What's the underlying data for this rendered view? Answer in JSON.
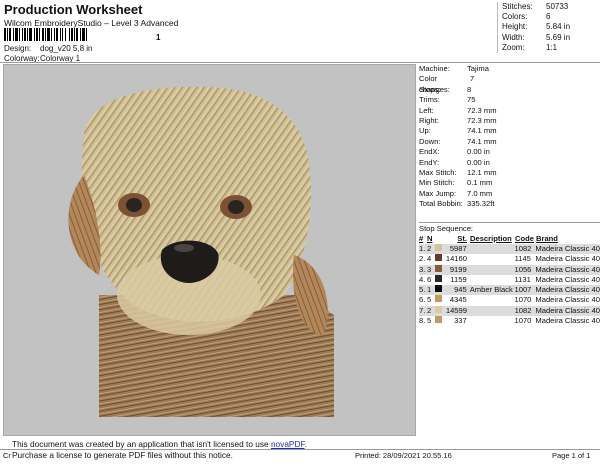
{
  "header": {
    "title": "Production Worksheet",
    "subtitle": "Wilcom EmbroideryStudio – Level 3 Advanced",
    "barcode_suffix": "1",
    "design_label": "Design:",
    "design_value": "dog_v20 5,8 in",
    "colorway_label": "Colorway:",
    "colorway_value": "Colorway 1"
  },
  "stats": [
    {
      "k": "Stitches:",
      "v": "50733"
    },
    {
      "k": "Colors:",
      "v": "6"
    },
    {
      "k": "Height:",
      "v": "5.84 in"
    },
    {
      "k": "Width:",
      "v": "5.69 in"
    },
    {
      "k": "Zoom:",
      "v": "1:1"
    }
  ],
  "machine_info": [
    {
      "k": "Machine:",
      "v": "Tajima"
    },
    {
      "k": "Color changes:",
      "v": "7"
    },
    {
      "k": "Stops:",
      "v": "8"
    },
    {
      "k": "Trims:",
      "v": "75"
    },
    {
      "k": "Left:",
      "v": "72.3 mm"
    },
    {
      "k": "Right:",
      "v": "72.3 mm"
    },
    {
      "k": "Up:",
      "v": "74.1 mm"
    },
    {
      "k": "Down:",
      "v": "74.1 mm"
    },
    {
      "k": "EndX:",
      "v": "0.00 in"
    },
    {
      "k": "EndY:",
      "v": "0.00 in"
    },
    {
      "k": "Max Stitch:",
      "v": "12.1 mm"
    },
    {
      "k": "Min Stitch:",
      "v": "0.1 mm"
    },
    {
      "k": "Max Jump:",
      "v": "7.0 mm"
    },
    {
      "k": "Total Bobbin:",
      "v": "335.32ft"
    }
  ],
  "stop_sequence": {
    "title": "Stop Sequence:",
    "headers": {
      "num": "#",
      "n": "N",
      "st": "St.",
      "desc": "Description",
      "code": "Code",
      "brand": "Brand"
    },
    "rows": [
      {
        "num": "1.",
        "n": "2",
        "color": "#d4c49a",
        "st": "5987",
        "desc": "",
        "code": "1082",
        "brand": "Madeira Classic 40"
      },
      {
        "num": "2.",
        "n": "4",
        "color": "#6b3a26",
        "st": "14160",
        "desc": "",
        "code": "1145",
        "brand": "Madeira Classic 40"
      },
      {
        "num": "3.",
        "n": "3",
        "color": "#8a5a3a",
        "st": "9199",
        "desc": "",
        "code": "1056",
        "brand": "Madeira Classic 40"
      },
      {
        "num": "4.",
        "n": "6",
        "color": "#2c2622",
        "st": "1159",
        "desc": "",
        "code": "1131",
        "brand": "Madeira Classic 40"
      },
      {
        "num": "5.",
        "n": "1",
        "color": "#0a0a0a",
        "st": "945",
        "desc": "Amber Black",
        "code": "1007",
        "brand": "Madeira Classic 40"
      },
      {
        "num": "6.",
        "n": "5",
        "color": "#c29a5e",
        "st": "4345",
        "desc": "",
        "code": "1070",
        "brand": "Madeira Classic 40"
      },
      {
        "num": "7.",
        "n": "2",
        "color": "#d9cba2",
        "st": "14599",
        "desc": "",
        "code": "1082",
        "brand": "Madeira Classic 40"
      },
      {
        "num": "8.",
        "n": "5",
        "color": "#c29a5e",
        "st": "337",
        "desc": "",
        "code": "1070",
        "brand": "Madeira Classic 40"
      }
    ]
  },
  "notice": {
    "line1_pre": "This document was created by an application that isn't licensed to use ",
    "link": "novaPDF",
    "line1_post": ".",
    "line2": "Purchase a license to generate PDF files without this notice."
  },
  "footer": {
    "left": "Cr",
    "printed": "Printed: 28/09/2021 20.55.16",
    "page": "Page 1 of 1"
  },
  "colors": {
    "canvas_bg": "#c2c2c2",
    "thread_light": "#d9c9a0",
    "thread_dark": "#7a5236",
    "nose": "#1e1c1b"
  }
}
